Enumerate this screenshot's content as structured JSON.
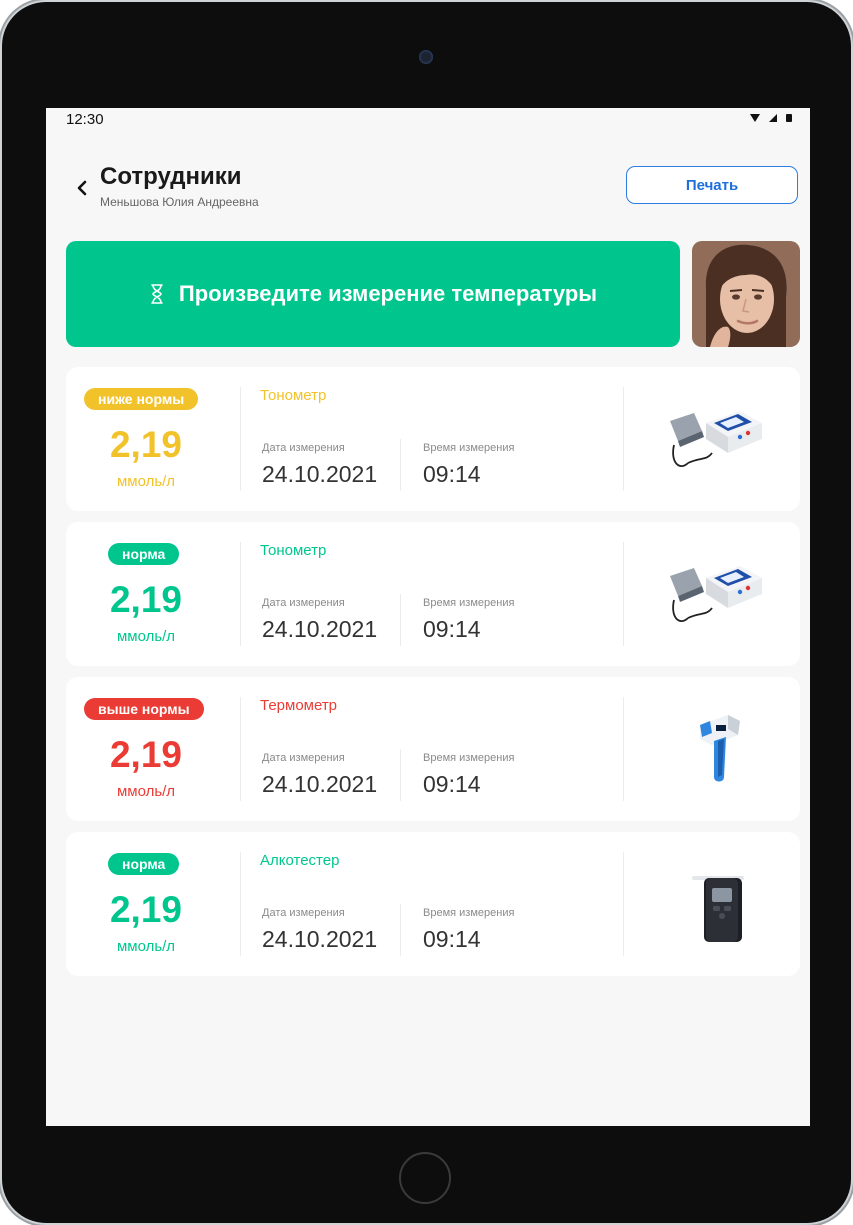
{
  "status_bar": {
    "time": "12:30"
  },
  "header": {
    "title": "Сотрудники",
    "subtitle": "Меньшова Юлия Андреевна",
    "print_label": "Печать"
  },
  "banner": {
    "text": "Произведите измерение температуры",
    "icon": "hourglass-icon"
  },
  "colors": {
    "low": "#f2c22b",
    "normal": "#00c68e",
    "high": "#ea3c35",
    "accent": "#2f7de1"
  },
  "labels": {
    "date": "Дата измерения",
    "time": "Время измерения"
  },
  "measurements": [
    {
      "status": "ниже нормы",
      "level": "low",
      "value": "2,19",
      "unit": "ммоль/л",
      "device": "Тонометр",
      "device_icon": "blood-pressure-monitor",
      "date": "24.10.2021",
      "time": "09:14"
    },
    {
      "status": "норма",
      "level": "normal",
      "value": "2,19",
      "unit": "ммоль/л",
      "device": "Тонометр",
      "device_icon": "blood-pressure-monitor",
      "date": "24.10.2021",
      "time": "09:14"
    },
    {
      "status": "выше нормы",
      "level": "high",
      "value": "2,19",
      "unit": "ммоль/л",
      "device": "Термометр",
      "device_icon": "infrared-thermometer",
      "date": "24.10.2021",
      "time": "09:14"
    },
    {
      "status": "норма",
      "level": "normal",
      "value": "2,19",
      "unit": "ммоль/л",
      "device": "Алкотестер",
      "device_icon": "breathalyzer",
      "date": "24.10.2021",
      "time": "09:14"
    }
  ]
}
